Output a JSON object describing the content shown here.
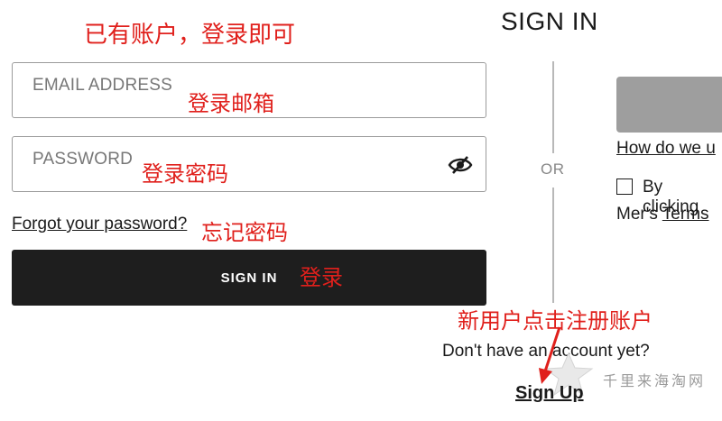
{
  "annotations": {
    "top": "已有账户，登录即可",
    "email": "登录邮箱",
    "password": "登录密码",
    "forgot": "忘记密码",
    "signin": "登录",
    "new_user": "新用户点击注册账户"
  },
  "page": {
    "title": "SIGN IN"
  },
  "login_form": {
    "email_placeholder": "EMAIL ADDRESS",
    "password_placeholder": "PASSWORD",
    "forgot_link": "Forgot your password?",
    "signin_label": "SIGN IN"
  },
  "divider": {
    "label": "OR"
  },
  "right_panel": {
    "how_link": "How do we u",
    "consent_text": "By clicking",
    "consent_line2_prefix": "Mer's",
    "terms_link": "Terms"
  },
  "signup": {
    "prompt": "Don't have an account yet?",
    "link": "Sign Up"
  },
  "watermark": {
    "text": "千里来海淘网"
  },
  "icons": {
    "password_toggle": "eye-slash-icon",
    "arrow": "red-arrow-icon"
  },
  "colors": {
    "annotation": "#e0201c",
    "button_dark": "#1e1e1e",
    "social_button": "#9e9e9e"
  }
}
